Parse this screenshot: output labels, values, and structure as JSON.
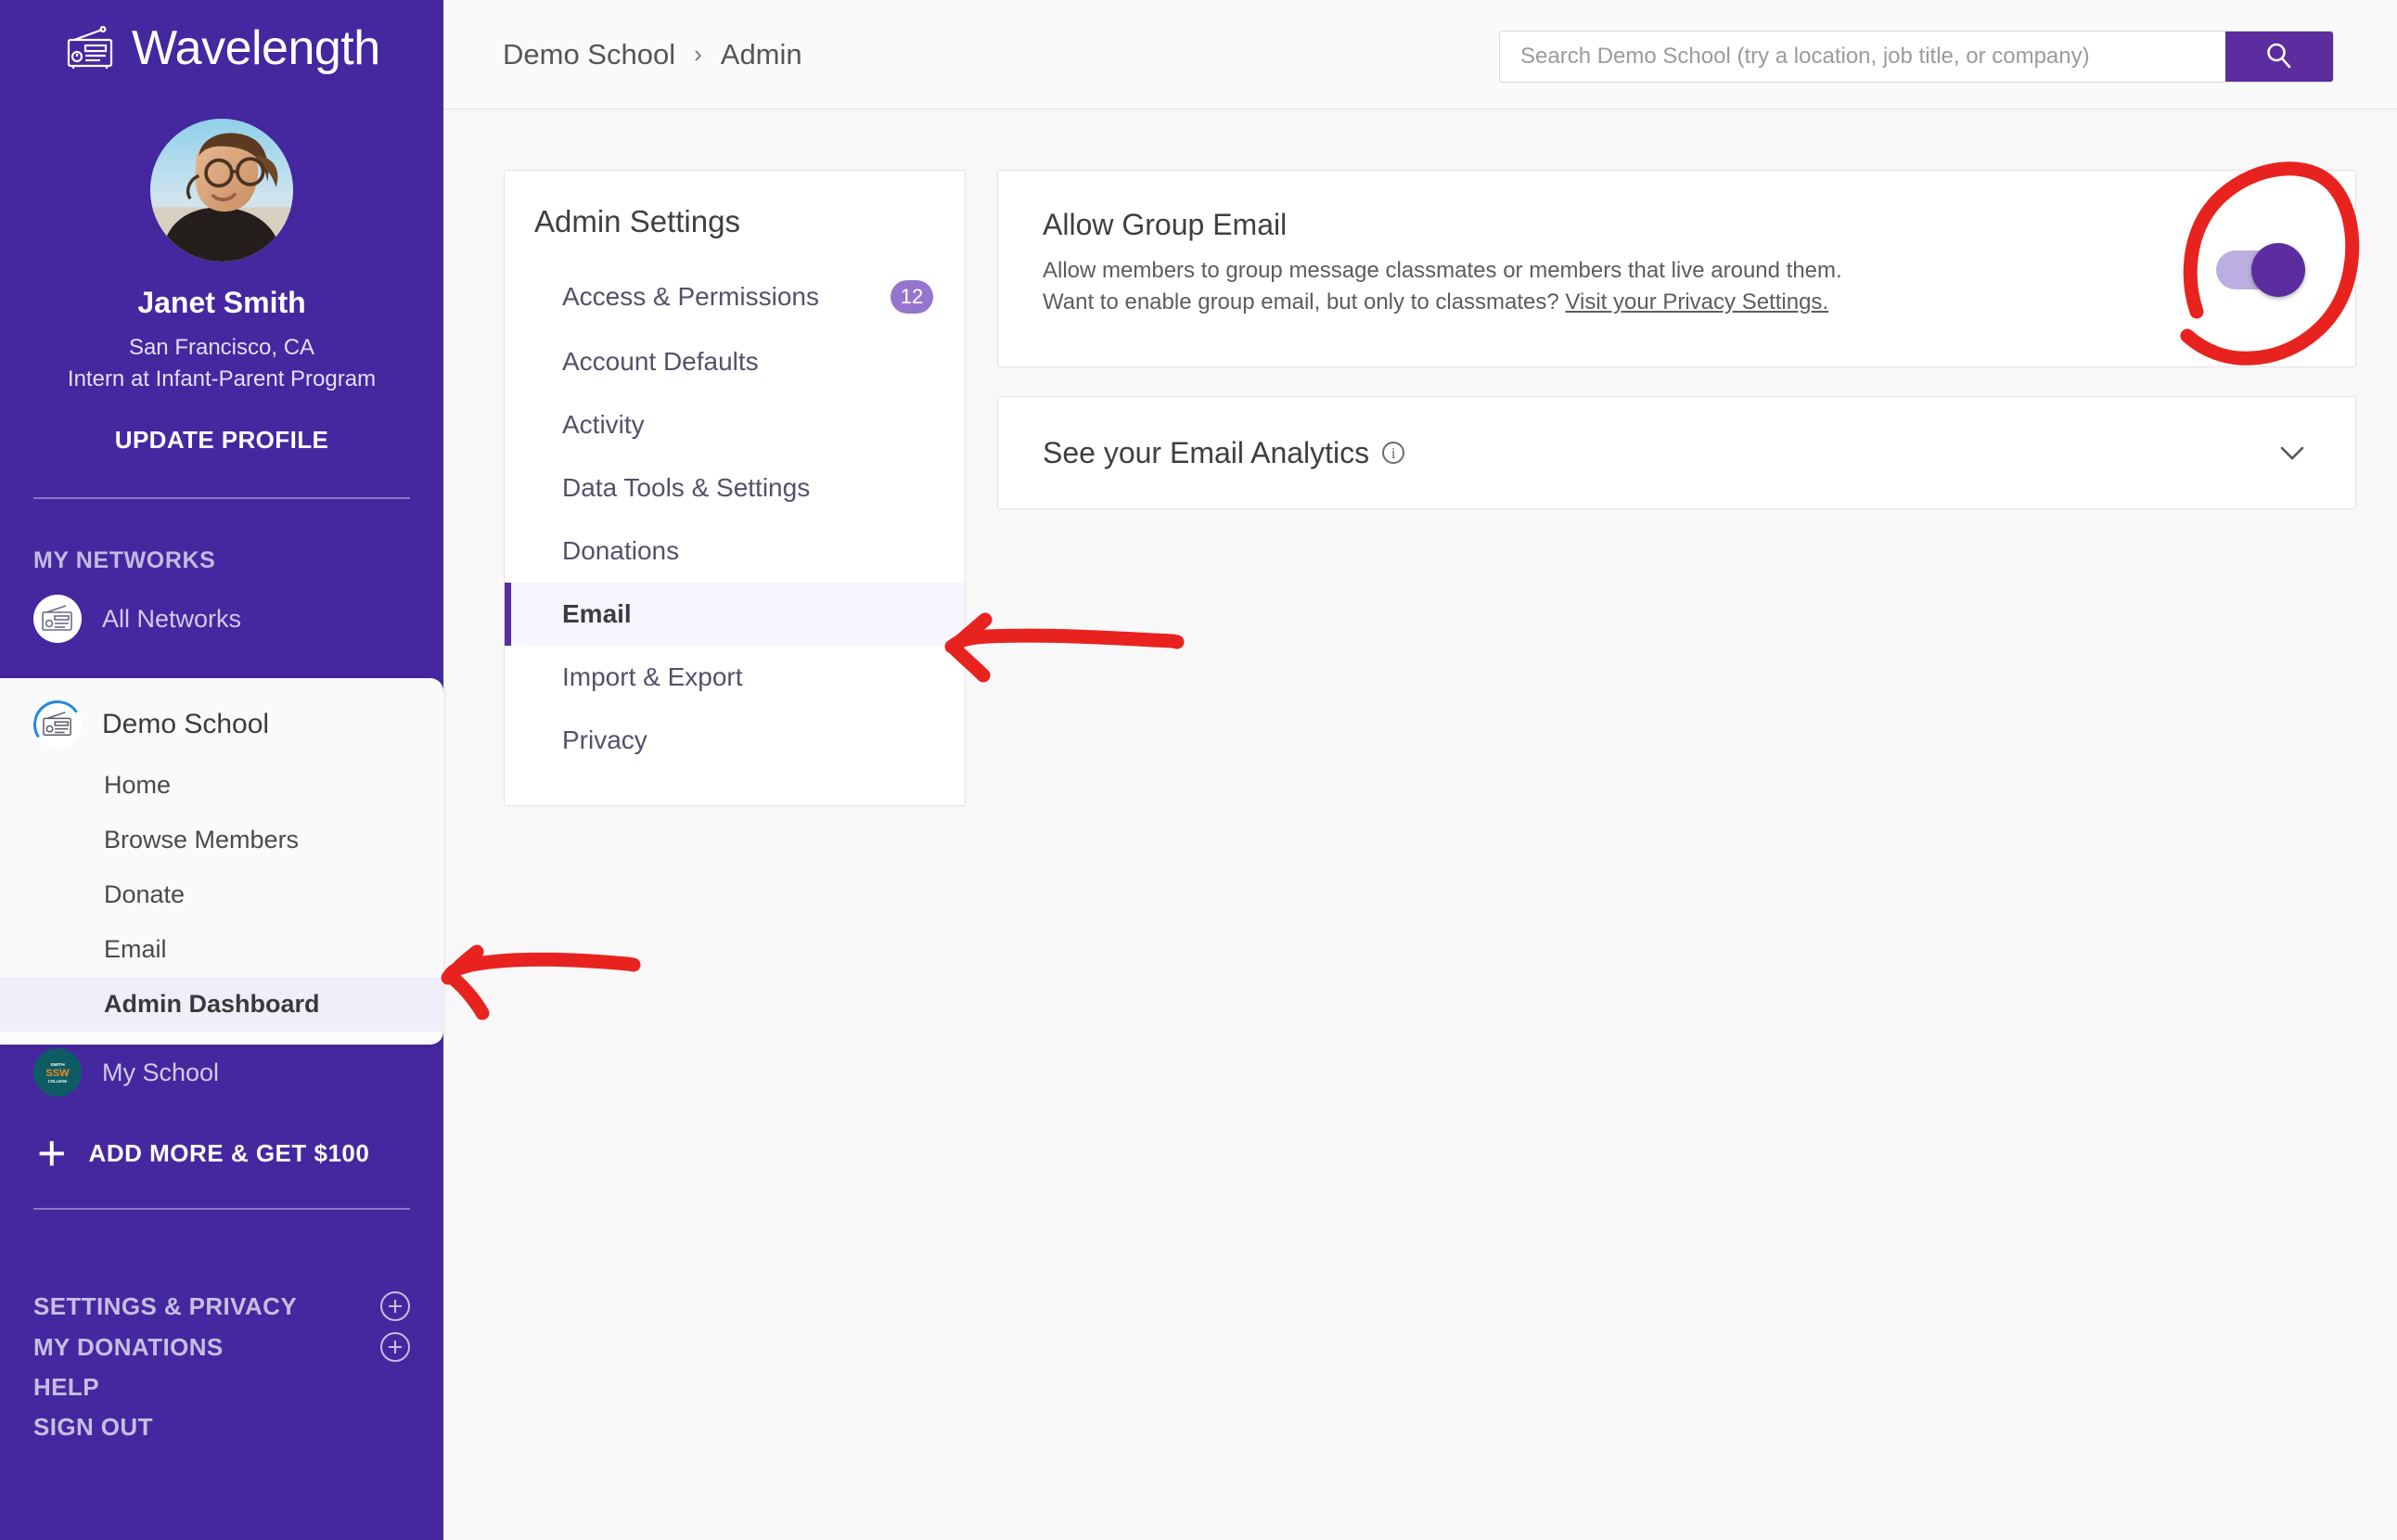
{
  "brand": {
    "name": "Wavelength",
    "logo_icon": "radio-icon"
  },
  "profile": {
    "avatar_alt": "Janet Smith profile photo",
    "name": "Janet Smith",
    "location": "San Francisco, CA",
    "title": "Intern at Infant-Parent Program",
    "update_profile_label": "UPDATE PROFILE"
  },
  "sidebar": {
    "networks_label": "MY NETWORKS",
    "all_networks": {
      "label": "All Networks",
      "icon": "radio-icon"
    },
    "school": {
      "name": "Demo School",
      "icon": "radio-icon",
      "links": [
        {
          "label": "Home",
          "active": false
        },
        {
          "label": "Browse Members",
          "active": false
        },
        {
          "label": "Donate",
          "active": false
        },
        {
          "label": "Email",
          "active": false
        },
        {
          "label": "Admin Dashboard",
          "active": true
        }
      ]
    },
    "my_school": {
      "label": "My School",
      "icon": "ssw-college-logo",
      "logo_text": {
        "top": "SMITH",
        "mid": "SSW",
        "bottom": "COLLEGE"
      }
    },
    "add_more": {
      "label": "ADD MORE & GET $100",
      "icon": "plus-icon"
    },
    "footer": [
      {
        "label": "SETTINGS & PRIVACY",
        "has_plus": true
      },
      {
        "label": "MY DONATIONS",
        "has_plus": true
      },
      {
        "label": "HELP",
        "has_plus": false
      },
      {
        "label": "SIGN OUT",
        "has_plus": false
      }
    ]
  },
  "header": {
    "breadcrumb": [
      "Demo School",
      "Admin"
    ],
    "breadcrumb_separator": "›",
    "search": {
      "value": "",
      "placeholder": "Search Demo School (try a location, job title, or company)",
      "button_icon": "search-icon"
    }
  },
  "admin_settings": {
    "title": "Admin Settings",
    "items": [
      {
        "label": "Access & Permissions",
        "badge": "12",
        "active": false
      },
      {
        "label": "Account Defaults",
        "badge": null,
        "active": false
      },
      {
        "label": "Activity",
        "badge": null,
        "active": false
      },
      {
        "label": "Data Tools & Settings",
        "badge": null,
        "active": false
      },
      {
        "label": "Donations",
        "badge": null,
        "active": false
      },
      {
        "label": "Email",
        "badge": null,
        "active": true
      },
      {
        "label": "Import & Export",
        "badge": null,
        "active": false
      },
      {
        "label": "Privacy",
        "badge": null,
        "active": false
      }
    ]
  },
  "main": {
    "group_email": {
      "heading": "Allow Group Email",
      "desc_line1": "Allow members to group message classmates or members that live around them.",
      "desc_line2_pre": "Want to enable group email, but only to classmates? ",
      "desc_link": "Visit your Privacy Settings.",
      "toggle_state": "on"
    },
    "analytics": {
      "title": "See your Email Analytics",
      "info_icon": "info-icon",
      "expand_icon": "chevron-down-icon",
      "expanded": false
    }
  },
  "annotations": {
    "color": "#e8231f",
    "items": [
      {
        "name": "circle-around-group-email-toggle",
        "shape": "circle"
      },
      {
        "name": "arrow-pointing-to-email-settings-item",
        "shape": "arrow-left"
      },
      {
        "name": "arrow-pointing-to-admin-dashboard-link",
        "shape": "arrow-left"
      }
    ]
  },
  "colors": {
    "sidebar_purple": "#4527a0",
    "accent_purple": "#5b2d9e",
    "badge_purple": "#9575cd",
    "toggle_track": "#bcaee0",
    "page_background": "#f8f8f9",
    "annotation_red": "#e8231f"
  }
}
